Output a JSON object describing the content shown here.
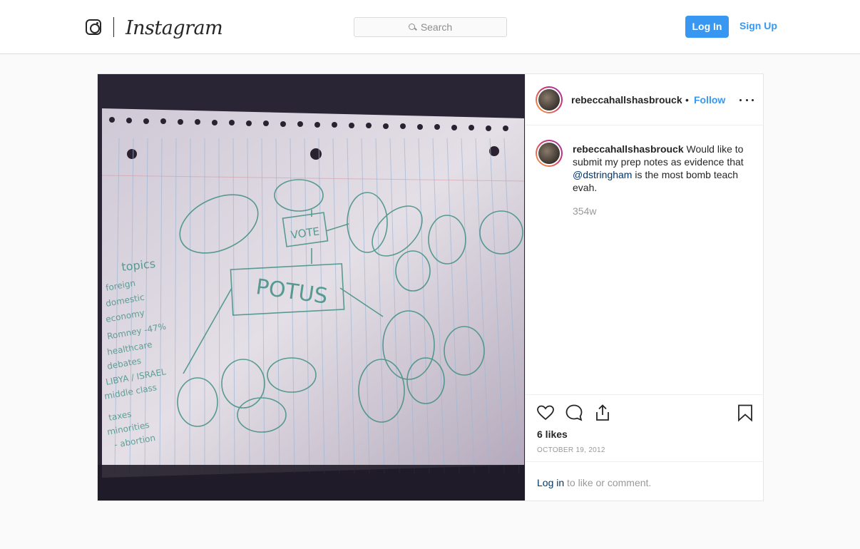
{
  "header": {
    "brand": "Instagram",
    "search_placeholder": "Search",
    "login_label": "Log In",
    "signup_label": "Sign Up"
  },
  "post": {
    "username": "rebeccahallshasbrouck",
    "separator": "•",
    "follow_label": "Follow",
    "caption": {
      "username": "rebeccahallshasbrouck",
      "text_before": " Would like to submit my prep notes as evidence that ",
      "mention": "@dstringham",
      "text_after": " is the most bomb teach evah."
    },
    "time_ago": "354w",
    "likes": "6 likes",
    "date": "OCTOBER 19, 2012",
    "comment_prompt": {
      "login_link": "Log in",
      "rest": " to like or comment."
    },
    "photo_notes": {
      "center": "POTUS",
      "vote": "VOTE",
      "topics_title": "topics",
      "topics": [
        "foreign",
        "domestic",
        "economy",
        "Romney -47%",
        "healthcare",
        "debates",
        "LIBYA / ISRAEL",
        "middle class",
        "taxes",
        "minorities",
        "- abortion"
      ]
    }
  },
  "icons": [
    "instagram-glyph-icon",
    "search-icon",
    "more-options-icon",
    "heart-icon",
    "comment-icon",
    "share-icon",
    "bookmark-icon"
  ]
}
